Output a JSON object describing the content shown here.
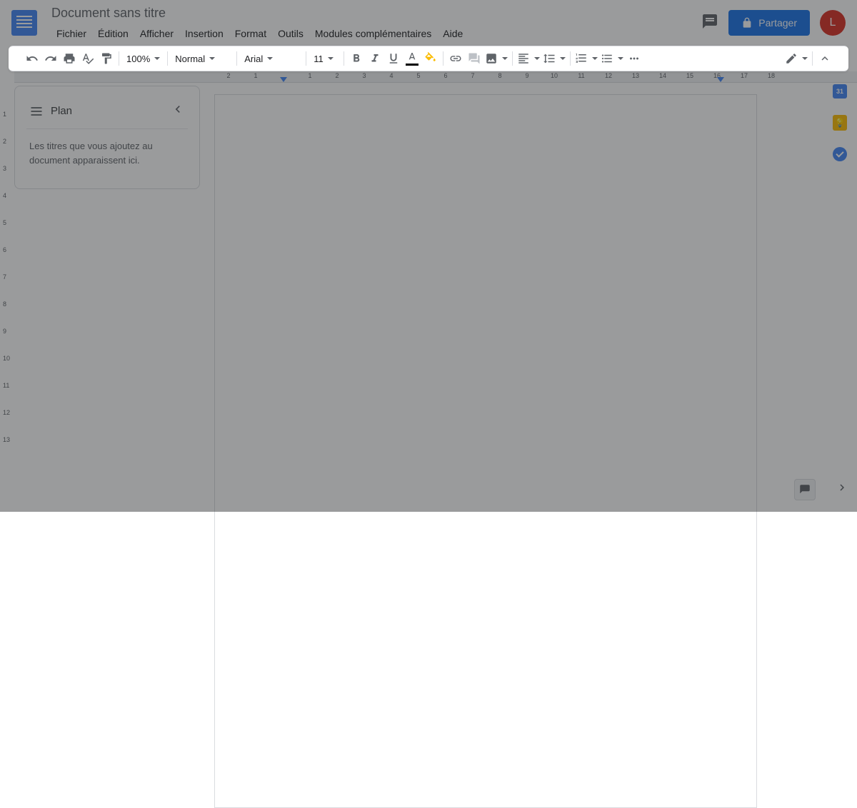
{
  "doc": {
    "title": "Document sans titre"
  },
  "menubar": [
    "Fichier",
    "Édition",
    "Afficher",
    "Insertion",
    "Format",
    "Outils",
    "Modules complémentaires",
    "Aide"
  ],
  "header": {
    "share_label": "Partager",
    "avatar_letter": "L"
  },
  "toolbar": {
    "zoom": "100%",
    "style": "Normal",
    "font": "Arial",
    "size": "11"
  },
  "outline": {
    "title": "Plan",
    "empty_text": "Les titres que vous ajoutez au document apparaissent ici."
  },
  "ruler": {
    "top": [
      "2",
      "1",
      "",
      "1",
      "2",
      "3",
      "4",
      "5",
      "6",
      "7",
      "8",
      "9",
      "10",
      "11",
      "12",
      "13",
      "14",
      "15",
      "16",
      "17",
      "18"
    ],
    "left": [
      "",
      "1",
      "2",
      "3",
      "4",
      "5",
      "6",
      "7",
      "8",
      "9",
      "10",
      "11",
      "12",
      "13"
    ]
  },
  "side": {
    "calendar_day": "31"
  }
}
